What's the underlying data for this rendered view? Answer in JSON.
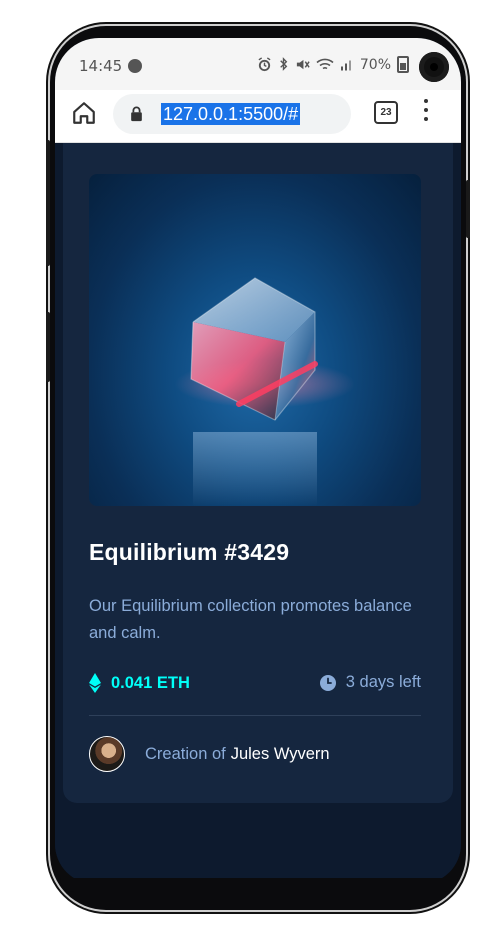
{
  "statusbar": {
    "time": "14:45",
    "battery": "70%",
    "icons": [
      "alarm-icon",
      "bluetooth-icon",
      "mute-icon",
      "wifi-icon",
      "signal-icon",
      "battery-icon"
    ]
  },
  "browser": {
    "url": "127.0.0.1:5500/#",
    "tab_count": "23"
  },
  "card": {
    "title": "Equilibrium #3429",
    "description": "Our Equilibrium collection promotes balance and calm.",
    "price": "0.041 ETH",
    "time_left": "3 days left",
    "creator_prefix": "Creation of",
    "creator_name": "Jules Wyvern"
  },
  "colors": {
    "page_bg": "#0d1a2e",
    "card_bg": "#15263f",
    "accent_cyan": "#00fff8",
    "soft_blue": "#8bacd9",
    "divider": "#2e405a"
  }
}
